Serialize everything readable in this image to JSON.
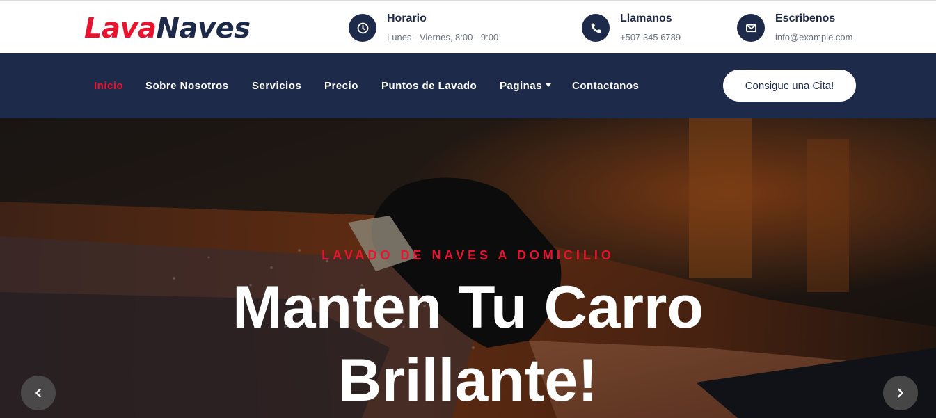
{
  "brand": {
    "part1": "Lava",
    "part2": "Naves"
  },
  "contact": {
    "hours": {
      "title": "Horario",
      "value": "Lunes - Viernes, 8:00 - 9:00",
      "icon": "clock-icon"
    },
    "phone": {
      "title": "Llamanos",
      "value": "+507 345 6789",
      "icon": "phone-icon"
    },
    "email": {
      "title": "Escribenos",
      "value": "info@example.com",
      "icon": "envelope-icon"
    }
  },
  "nav": {
    "items": [
      {
        "label": "Inicio",
        "active": true
      },
      {
        "label": "Sobre Nosotros"
      },
      {
        "label": "Servicios"
      },
      {
        "label": "Precio"
      },
      {
        "label": "Puntos de Lavado"
      },
      {
        "label": "Paginas",
        "dropdown": true
      },
      {
        "label": "Contactanos"
      }
    ],
    "cta": "Consigue una Cita!"
  },
  "hero": {
    "subtitle": "LAVADO DE NAVES A DOMICILIO",
    "title_line1": "Manten Tu Carro",
    "title_line2": "Brillante!"
  },
  "colors": {
    "accent": "#e8132f",
    "navy": "#1e2a4a"
  }
}
